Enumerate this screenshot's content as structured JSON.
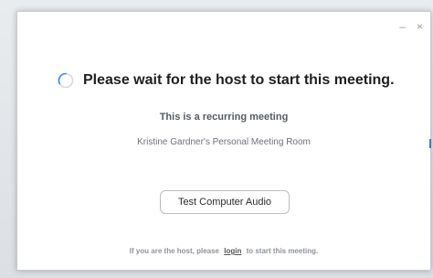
{
  "window": {
    "minimize_symbol": "–",
    "close_symbol": "×"
  },
  "main": {
    "headline": "Please wait for the host to start this meeting.",
    "subtitle": "This is a recurring meeting",
    "room_name": "Kristine Gardner's Personal Meeting Room",
    "test_audio_label": "Test Computer Audio"
  },
  "footer": {
    "prefix": "If you are the host, please",
    "login_label": "login",
    "suffix": "to start this meeting."
  },
  "icons": {
    "spinner": "loading-spinner-icon"
  },
  "colors": {
    "spinner_ring": "#d7dade",
    "spinner_arc": "#2d8cff",
    "headline": "#1f1f1f"
  }
}
